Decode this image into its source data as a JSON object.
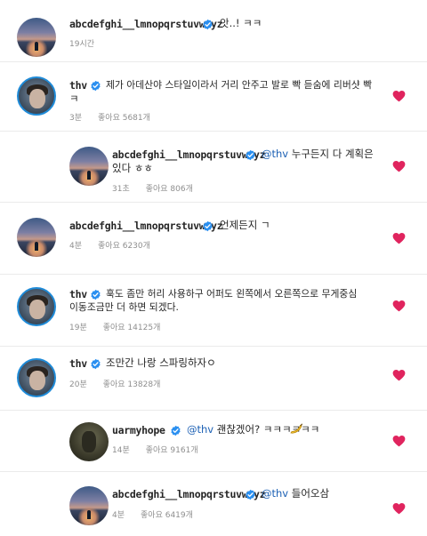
{
  "colors": {
    "heart": "#e0245e",
    "verified": "#2a8ff0",
    "mention": "#1a5fb4",
    "meta": "#8e8e8e"
  },
  "icons": {
    "verified": "verified-badge-icon",
    "heart": "heart-icon",
    "emoji": "banana-emoji"
  },
  "comments": [
    {
      "user": "abcdefghi__lmnopqrstuvwxyz",
      "verified": true,
      "text": "앗..! ㅋㅋ",
      "time": "19시간",
      "likes": "",
      "reply": false,
      "avatar": "sunset",
      "liked": false
    },
    {
      "user": "thv",
      "verified": true,
      "text_line1": "제가 아데산야 스타일이라서 거리 안주고 발로 빡 듣숨에 리버샷 빡",
      "text_line2": "ㅋ",
      "time": "3분",
      "likes": "좋아요 5681개",
      "reply": false,
      "avatar": "thv",
      "liked": true
    },
    {
      "user": "abcdefghi__lmnopqrstuvwxyz",
      "verified": true,
      "mention": "@thv",
      "text_line1": " 누구든지 다 계획은",
      "text_line2": "있다 ㅎㅎ",
      "time": "31초",
      "likes": "좋아요 806개",
      "reply": true,
      "avatar": "sunset",
      "liked": true
    },
    {
      "user": "abcdefghi__lmnopqrstuvwxyz",
      "verified": true,
      "text": "언제든지 ㄱ",
      "time": "4분",
      "likes": "좋아요 6230개",
      "reply": false,
      "avatar": "sunset",
      "liked": true
    },
    {
      "user": "thv",
      "verified": true,
      "text_line1": "훅도 좀만 허리 사용하구 어퍼도 왼쪽에서 오른쪽으로 무게중심",
      "text_line2": "이동조금만 더 하면 되겠다.",
      "time": "19분",
      "likes": "좋아요 14125개",
      "reply": false,
      "avatar": "thv",
      "liked": true
    },
    {
      "user": "thv",
      "verified": true,
      "text": "조만간 나랑 스파링하자ㅇ",
      "time": "20분",
      "likes": "좋아요 13828개",
      "reply": false,
      "avatar": "thv",
      "liked": true
    },
    {
      "user": "uarmyhope",
      "verified": true,
      "mention": "@thv",
      "text": " 괜찮겠어? ㅋㅋㅋㅋㅋㅋ",
      "time": "14분",
      "likes": "좋아요 9161개",
      "reply": true,
      "avatar": "hope",
      "liked": true
    },
    {
      "user": "abcdefghi__lmnopqrstuvwxyz",
      "verified": true,
      "mention": "@thv",
      "text": " 들어오삼",
      "time": "4분",
      "likes": "좋아요 6419개",
      "reply": true,
      "avatar": "sunset",
      "liked": true
    }
  ]
}
